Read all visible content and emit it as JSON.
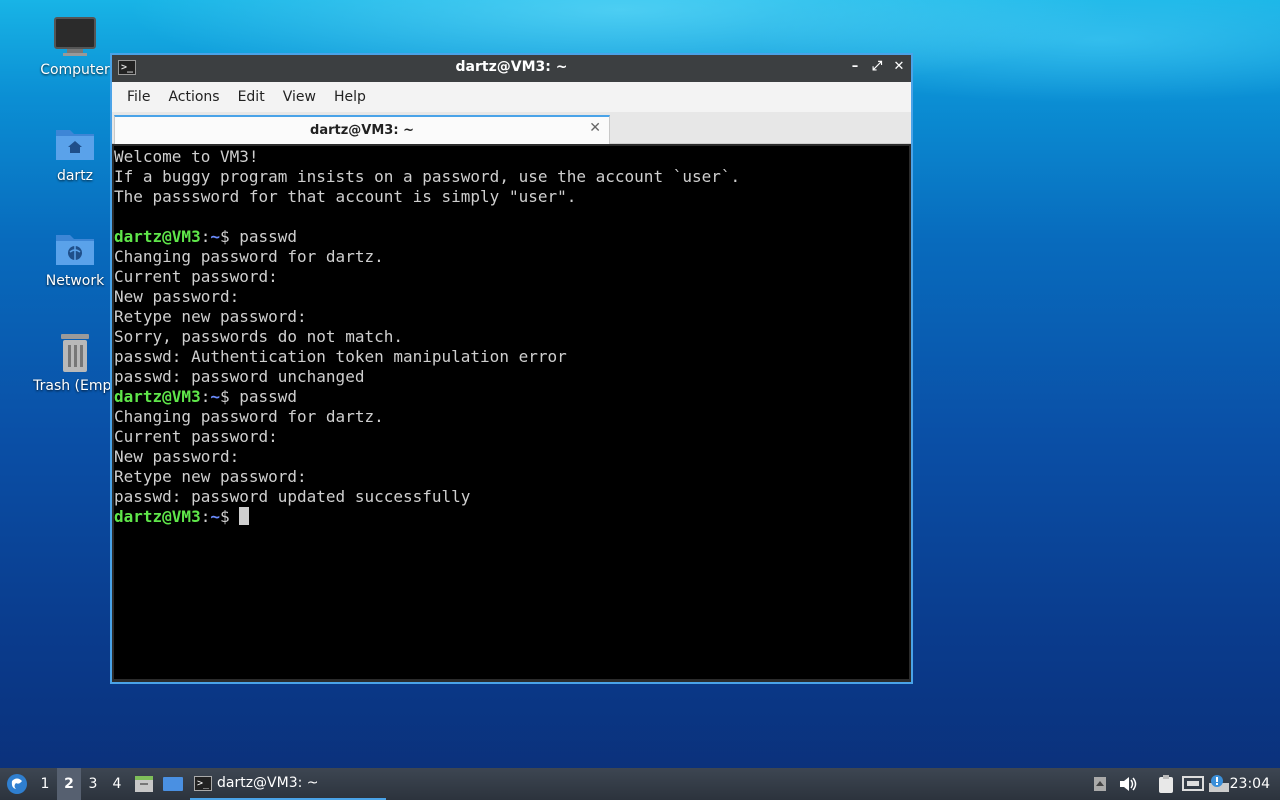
{
  "desktop": {
    "icons": [
      {
        "label": "Computer",
        "icon": "monitor-icon"
      },
      {
        "label": "dartz",
        "icon": "home-folder-icon"
      },
      {
        "label": "Network",
        "icon": "network-folder-icon"
      },
      {
        "label": "Trash (Empt",
        "icon": "trash-icon"
      }
    ]
  },
  "window": {
    "title": "dartz@VM3: ~",
    "controls": {
      "minimize": "–",
      "maximize": "⤢",
      "close": "✕"
    },
    "menu": [
      "File",
      "Actions",
      "Edit",
      "View",
      "Help"
    ],
    "tab": {
      "label": "dartz@VM3: ~",
      "close": "✕"
    }
  },
  "terminal": {
    "lines": [
      {
        "text": "Welcome to VM3!"
      },
      {
        "text": "If a buggy program insists on a password, use the account `user`."
      },
      {
        "text": "The passsword for that account is simply \"user\"."
      },
      {
        "text": ""
      },
      {
        "prompt_user": "dartz@VM3",
        "prompt_sep": ":",
        "prompt_path": "~",
        "prompt_end": "$ ",
        "text": "passwd"
      },
      {
        "text": "Changing password for dartz."
      },
      {
        "text": "Current password:"
      },
      {
        "text": "New password:"
      },
      {
        "text": "Retype new password:"
      },
      {
        "text": "Sorry, passwords do not match."
      },
      {
        "text": "passwd: Authentication token manipulation error"
      },
      {
        "text": "passwd: password unchanged"
      },
      {
        "prompt_user": "dartz@VM3",
        "prompt_sep": ":",
        "prompt_path": "~",
        "prompt_end": "$ ",
        "text": "passwd"
      },
      {
        "text": "Changing password for dartz."
      },
      {
        "text": "Current password:"
      },
      {
        "text": "New password:"
      },
      {
        "text": "Retype new password:"
      },
      {
        "text": "passwd: password updated successfully"
      },
      {
        "prompt_user": "dartz@VM3",
        "prompt_sep": ":",
        "prompt_path": "~",
        "prompt_end": "$ ",
        "text": "",
        "cursor": true
      }
    ]
  },
  "taskbar": {
    "workspaces": [
      "1",
      "2",
      "3",
      "4"
    ],
    "active_workspace": "2",
    "task_label": "dartz@VM3: ~",
    "clock": "23:04",
    "colors": {
      "accent": "#4aa3e8",
      "prompt_user": "#5fe64a",
      "prompt_path": "#6b8cff"
    }
  }
}
